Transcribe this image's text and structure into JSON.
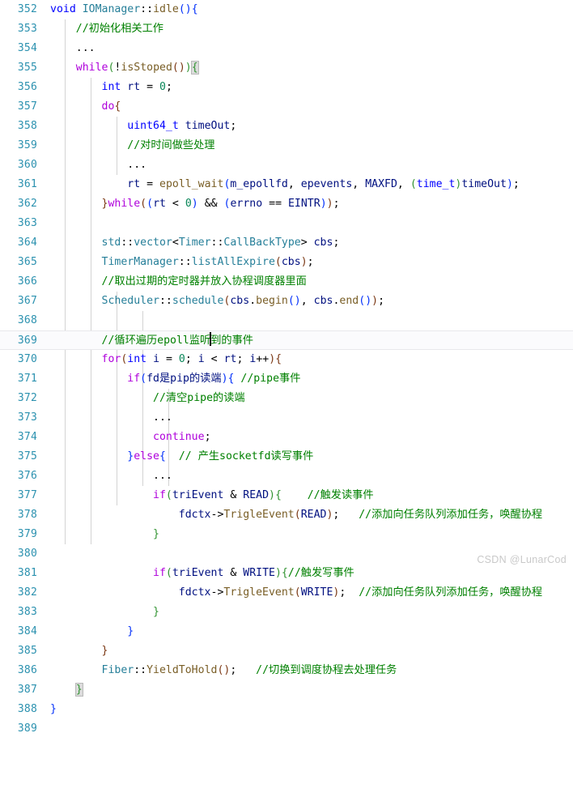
{
  "editor": {
    "language": "C++",
    "theme": "light-plus",
    "first_line_number": 352,
    "last_line_number": 389,
    "current_line_number": 369,
    "colors": {
      "background": "#ffffff",
      "line_number": "#2b91af",
      "keyword": "#af00db",
      "type": "#0000ff",
      "comment": "#008000",
      "function": "#795e26",
      "class": "#267f99",
      "number": "#098658",
      "plain": "#000000",
      "bracket_level_0": "#0431fa",
      "bracket_level_1": "#319331",
      "bracket_level_2": "#7b3814",
      "current_line_background": "#fbfbfd",
      "indent_guide": "#d3d3d3",
      "brace_match_background": "#dcdcdc",
      "watermark": "#c9c9c9"
    }
  },
  "watermark": {
    "text": "CSDN @LunarCod"
  },
  "lines": [
    {
      "n": "352",
      "text": "void IOManager::idle(){"
    },
    {
      "n": "353",
      "text": "    //初始化相关工作"
    },
    {
      "n": "354",
      "text": "    ..."
    },
    {
      "n": "355",
      "text": "    while(!isStoped()){"
    },
    {
      "n": "356",
      "text": "        int rt = 0;"
    },
    {
      "n": "357",
      "text": "        do{"
    },
    {
      "n": "358",
      "text": "            uint64_t timeOut;"
    },
    {
      "n": "359",
      "text": "            //对时间做些处理"
    },
    {
      "n": "360",
      "text": "            ..."
    },
    {
      "n": "361",
      "text": "            rt = epoll_wait(m_epollfd, epevents, MAXFD, (time_t)timeOut);"
    },
    {
      "n": "362",
      "text": "        }while((rt < 0) && (errno == EINTR));"
    },
    {
      "n": "363",
      "text": ""
    },
    {
      "n": "364",
      "text": "        std::vector<Timer::CallBackType> cbs;"
    },
    {
      "n": "365",
      "text": "        TimerManager::listAllExpire(cbs);"
    },
    {
      "n": "366",
      "text": "        //取出过期的定时器并放入协程调度器里面"
    },
    {
      "n": "367",
      "text": "        Scheduler::schedule(cbs.begin(), cbs.end());"
    },
    {
      "n": "368",
      "text": ""
    },
    {
      "n": "369",
      "text": "        //循环遍历epoll监听到的事件"
    },
    {
      "n": "370",
      "text": "        for(int i = 0; i < rt; i++){"
    },
    {
      "n": "371",
      "text": "            if(fd是pip的读端){ //pipe事件"
    },
    {
      "n": "372",
      "text": "                //清空pipe的读端"
    },
    {
      "n": "373",
      "text": "                ..."
    },
    {
      "n": "374",
      "text": "                continue;"
    },
    {
      "n": "375",
      "text": "            }else{  // 产生socketfd读写事件"
    },
    {
      "n": "376",
      "text": "                ..."
    },
    {
      "n": "377",
      "text": "                if(triEvent & READ){    //触发读事件"
    },
    {
      "n": "378",
      "text": "                    fdctx->TrigleEvent(READ);   //添加向任务队列添加任务，唤醒协程"
    },
    {
      "n": "379",
      "text": "                }"
    },
    {
      "n": "380",
      "text": ""
    },
    {
      "n": "381",
      "text": "                if(triEvent & WRITE){//触发写事件"
    },
    {
      "n": "382",
      "text": "                    fdctx->TrigleEvent(WRITE);  //添加向任务队列添加任务，唤醒协程"
    },
    {
      "n": "383",
      "text": "                }"
    },
    {
      "n": "384",
      "text": "            }"
    },
    {
      "n": "385",
      "text": "        }"
    },
    {
      "n": "386",
      "text": "        Fiber::YieldToHold();   //切换到调度协程去处理任务"
    },
    {
      "n": "387",
      "text": "    }"
    },
    {
      "n": "388",
      "text": "}"
    },
    {
      "n": "389",
      "text": ""
    }
  ]
}
